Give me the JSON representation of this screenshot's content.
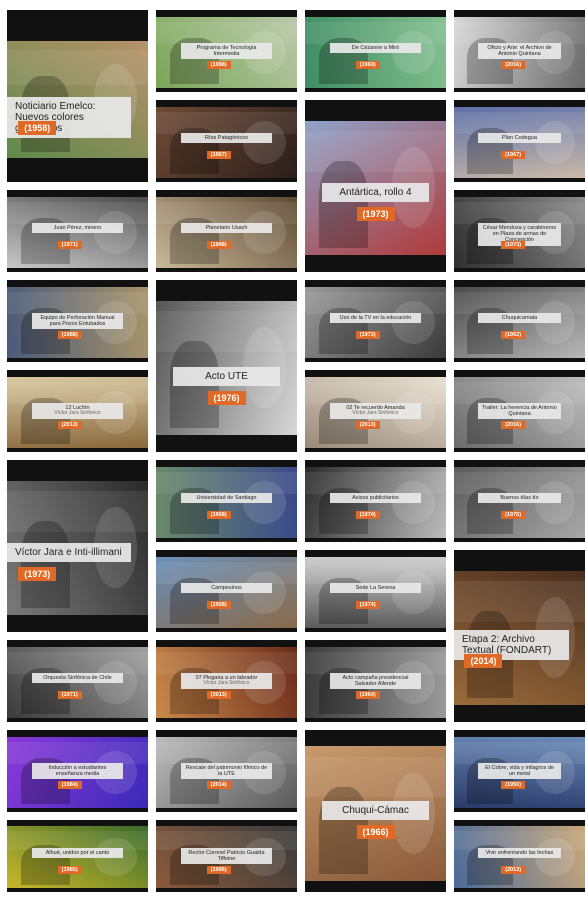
{
  "tiles": [
    {
      "key": "t01",
      "title": "Noticiario Emelco: Nuevos colores ganaderos",
      "year": "(1958)",
      "subtitle": "",
      "colors": [
        "#5f8a4a",
        "#b8926a"
      ],
      "bw": false
    },
    {
      "key": "t02",
      "title": "Programa de Tecnología Intermedia",
      "year": "(1988)",
      "subtitle": "",
      "colors": [
        "#7aa657",
        "#b9c8a8"
      ],
      "bw": false
    },
    {
      "key": "t03",
      "title": "De Cézanne a Miró",
      "year": "(1969)",
      "subtitle": "",
      "colors": [
        "#3f8d63",
        "#84c090"
      ],
      "bw": false
    },
    {
      "key": "t04",
      "title": "Oficio y Arte: el Archivo de Antonio Quintana",
      "year": "(2016)",
      "subtitle": "",
      "colors": [
        "#d8d8d8",
        "#6a6a6a"
      ],
      "bw": true
    },
    {
      "key": "t05",
      "title": "Ríos Patagónicos",
      "year": "(1967)",
      "subtitle": "",
      "colors": [
        "#6e4a36",
        "#2b1e1a"
      ],
      "bw": false
    },
    {
      "key": "t06",
      "title": "Antártica, rollo 4",
      "year": "(1973)",
      "subtitle": "",
      "colors": [
        "#8fa3c9",
        "#b03a3a"
      ],
      "bw": false
    },
    {
      "key": "t07",
      "title": "Plan Codegua",
      "year": "(1967)",
      "subtitle": "",
      "colors": [
        "#5c6fa8",
        "#c9b9a8"
      ],
      "bw": false
    },
    {
      "key": "t08",
      "title": "Juan Pérez, minero",
      "year": "(1971)",
      "subtitle": "",
      "colors": [
        "#4a4a4a",
        "#c9c9c9"
      ],
      "bw": true
    },
    {
      "key": "t09",
      "title": "Planetario Usach",
      "year": "(1988)",
      "subtitle": "",
      "colors": [
        "#5e4a33",
        "#c9b89a"
      ],
      "bw": false
    },
    {
      "key": "t10",
      "title": "César Mendoza y carabineros en Plaza de armas de Concepción",
      "year": "(1973)",
      "subtitle": "",
      "colors": [
        "#8a8a8a",
        "#2e2e2e"
      ],
      "bw": true
    },
    {
      "key": "t11",
      "title": "Equipo de Perforación Manual para Pozos Entubados",
      "year": "(1988)",
      "subtitle": "",
      "colors": [
        "#a8946a",
        "#4a5a7a"
      ],
      "bw": false
    },
    {
      "key": "t12",
      "title": "Acto UTE",
      "year": "(1976)",
      "subtitle": "",
      "colors": [
        "#d8d8d8",
        "#555555"
      ],
      "bw": true
    },
    {
      "key": "t13",
      "title": "Uso de la TV en la educación",
      "year": "(1973)",
      "subtitle": "",
      "colors": [
        "#3a3a3a",
        "#9a9a9a"
      ],
      "bw": true
    },
    {
      "key": "t14",
      "title": "Chuquicamata",
      "year": "(1962)",
      "subtitle": "",
      "colors": [
        "#b8b8b8",
        "#4a4a4a"
      ],
      "bw": true
    },
    {
      "key": "t15",
      "title": "12 Luchín",
      "year": "(2013)",
      "subtitle": "Víctor Jara Sinfónico",
      "colors": [
        "#8a6a3e",
        "#d8c8a0"
      ],
      "bw": false
    },
    {
      "key": "t16",
      "title": "02 Te recuerdo Amanda",
      "year": "(2013)",
      "subtitle": "Víctor Jara Sinfónico",
      "colors": [
        "#9a8a7a",
        "#e8e0d0"
      ],
      "bw": false
    },
    {
      "key": "t17",
      "title": "Trailer: La herencia de Antonio Quintana",
      "year": "(2016)",
      "subtitle": "",
      "colors": [
        "#6a6a6a",
        "#bdbdbd"
      ],
      "bw": true
    },
    {
      "key": "t18",
      "title": "Víctor Jara e Inti-illimani",
      "year": "(1973)",
      "subtitle": "",
      "colors": [
        "#7a7a7a",
        "#2a2a2a"
      ],
      "bw": true
    },
    {
      "key": "t19",
      "title": "Universidad de Santiago",
      "year": "(1968)",
      "subtitle": "",
      "colors": [
        "#6a8a6a",
        "#3a4a8a"
      ],
      "bw": false
    },
    {
      "key": "t20",
      "title": "Avisos publicitarios",
      "year": "(1974)",
      "subtitle": "",
      "colors": [
        "#2a2a2a",
        "#bdbdbd"
      ],
      "bw": true
    },
    {
      "key": "t21",
      "title": "Buenos días tío",
      "year": "(1975)",
      "subtitle": "",
      "colors": [
        "#5a5a5a",
        "#a8a8a8"
      ],
      "bw": true
    },
    {
      "key": "t22",
      "title": "Campesinos",
      "year": "(1958)",
      "subtitle": "",
      "colors": [
        "#6a8fb8",
        "#8a6a4a"
      ],
      "bw": false
    },
    {
      "key": "t23",
      "title": "Sede La Serena",
      "year": "(1974)",
      "subtitle": "",
      "colors": [
        "#d0d0d0",
        "#5a5a5a"
      ],
      "bw": true
    },
    {
      "key": "t24",
      "title": "Etapa 2: Archivo Textual (FONDART)",
      "year": "(2014)",
      "subtitle": "",
      "colors": [
        "#4a2e1e",
        "#9a6a3a"
      ],
      "bw": false
    },
    {
      "key": "t25",
      "title": "Orquesta Sinfónica de Chile",
      "year": "(1971)",
      "subtitle": "",
      "colors": [
        "#a0a0a0",
        "#3a3a3a"
      ],
      "bw": true
    },
    {
      "key": "t26",
      "title": "07 Plegaria a un labrador",
      "year": "(2013)",
      "subtitle": "Víctor Jara Sinfónico",
      "colors": [
        "#6a2a1a",
        "#c98a4a"
      ],
      "bw": false
    },
    {
      "key": "t27",
      "title": "Acto campaña presidencial Salvador Allende",
      "year": "(1964)",
      "subtitle": "",
      "colors": [
        "#9a9a9a",
        "#3a3a3a"
      ],
      "bw": true
    },
    {
      "key": "t28",
      "title": "Inducción a estudiantes enseñanza media",
      "year": "(1984)",
      "subtitle": "",
      "colors": [
        "#3a2ab8",
        "#8a3ad8"
      ],
      "bw": false
    },
    {
      "key": "t29",
      "title": "Rescate del patrimonio fílmico de la UTE",
      "year": "(2014)",
      "subtitle": "",
      "colors": [
        "#5a5a5a",
        "#bcbcbc"
      ],
      "bw": true
    },
    {
      "key": "t30",
      "title": "Chuqui-Cámac",
      "year": "(1966)",
      "subtitle": "",
      "colors": [
        "#8a5a3a",
        "#c99a6a"
      ],
      "bw": false
    },
    {
      "key": "t31",
      "title": "El Cobre, vida y milagros de un metal",
      "year": "(1950)",
      "subtitle": "",
      "colors": [
        "#2a3a6a",
        "#6a8ab8"
      ],
      "bw": false
    },
    {
      "key": "t32",
      "title": "Alhué, unidos por el canto",
      "year": "(1985)",
      "subtitle": "",
      "colors": [
        "#c9b82a",
        "#3a6a2a"
      ],
      "bw": false
    },
    {
      "key": "t33",
      "title": "Rector Coronel Patricio Gualda Tiffeine",
      "year": "(1986)",
      "subtitle": "",
      "colors": [
        "#8a5a3a",
        "#3a3a3a"
      ],
      "bw": false
    },
    {
      "key": "t34",
      "title": "Vivir enfrentando las fechas",
      "year": "(2013)",
      "subtitle": "",
      "colors": [
        "#4a6a9a",
        "#c9a87a"
      ],
      "bw": false
    }
  ]
}
